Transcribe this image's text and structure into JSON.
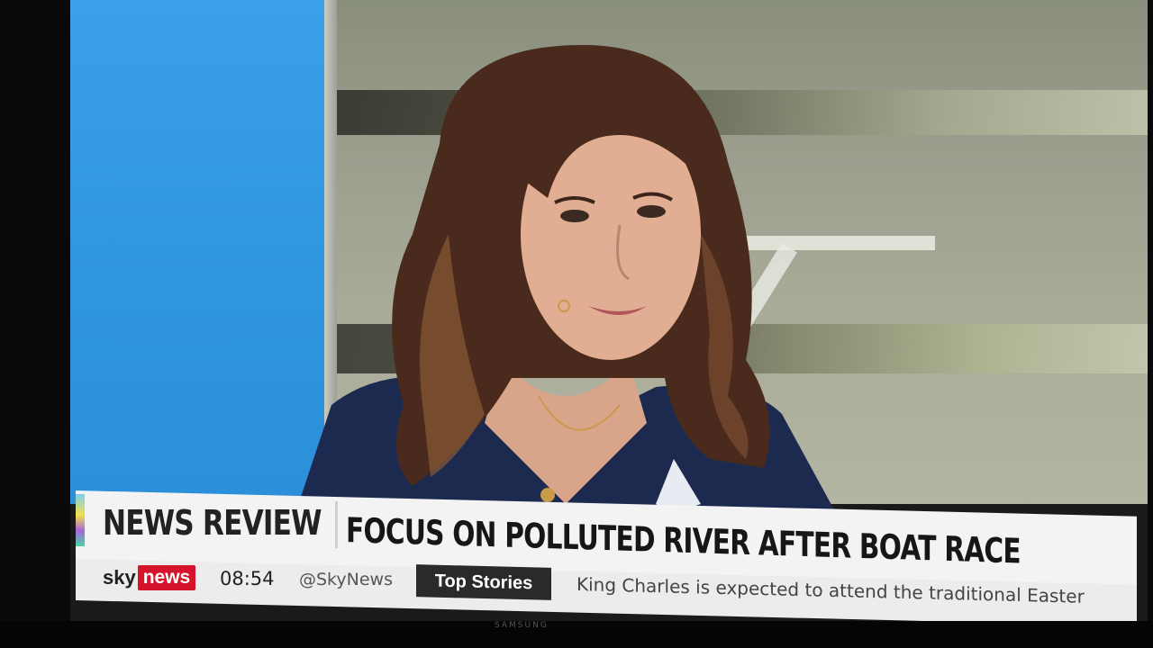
{
  "lower_third": {
    "section_label": "NEWS REVIEW",
    "headline": "FOCUS ON POLLUTED RIVER AFTER BOAT RACE",
    "channel_sky": "sky",
    "channel_news": "news",
    "time": "08:54",
    "handle": "@SkyNews",
    "segment_tag": "Top Stories",
    "ticker_text": "King Charles is expected to attend the traditional Easter"
  },
  "tv_brand": "SAMSUNG",
  "colors": {
    "news_red": "#d4142a",
    "studio_blue": "#2e95e0",
    "tag_dark": "#2a2a2a"
  }
}
